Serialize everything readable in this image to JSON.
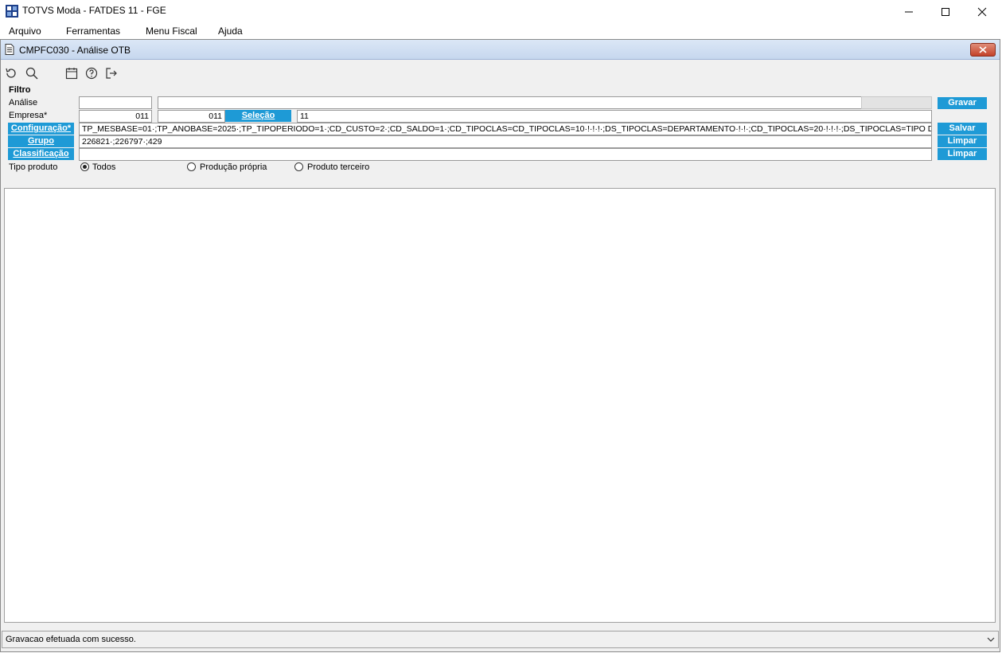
{
  "window": {
    "title": "TOTVS Moda - FATDES 11 - FGE",
    "minimize_icon": "minimize-icon",
    "maximize_icon": "maximize-icon",
    "close_icon": "close-icon"
  },
  "menu": {
    "items": [
      "Arquivo",
      "Ferramentas",
      "Menu Fiscal",
      "Ajuda"
    ]
  },
  "child": {
    "title": "CMPFC030 - Análise OTB"
  },
  "toolbar": {
    "icons": [
      "refresh-icon",
      "search-icon",
      "calendar-icon",
      "help-icon",
      "exit-icon"
    ]
  },
  "filter": {
    "heading": "Filtro",
    "analise_label": "Análise",
    "analise_value": "",
    "analise_desc": "",
    "empresa_label": "Empresa*",
    "empresa_value": "011",
    "empresa_value2": "011",
    "selecao_button": "Seleção",
    "selecao_value": "11",
    "configuracao_button": "Configuração*",
    "configuracao_value": "TP_MESBASE=01·;TP_ANOBASE=2025·;TP_TIPOPERIODO=1·;CD_CUSTO=2·;CD_SALDO=1·;CD_TIPOCLAS=CD_TIPOCLAS=10·!·!·!·;DS_TIPOCLAS=DEPARTAMENTO·!·!·;CD_TIPOCLAS=20·!·!·!·;DS_TIPOCLAS=TIPO DE PRO",
    "grupo_button": "Grupo",
    "grupo_value": "226821·;226797·;429",
    "classificacao_button": "Classificação",
    "classificacao_value": "",
    "tipo_produto_label": "Tipo produto",
    "radio_options": [
      "Todos",
      "Produção própria",
      "Produto terceiro"
    ],
    "radio_selected": "Todos",
    "gravar_button": "Gravar",
    "salvar_button": "Salvar",
    "limpar_grupo_button": "Limpar",
    "limpar_classificacao_button": "Limpar"
  },
  "status": {
    "text": "Gravacao efetuada com sucesso."
  }
}
